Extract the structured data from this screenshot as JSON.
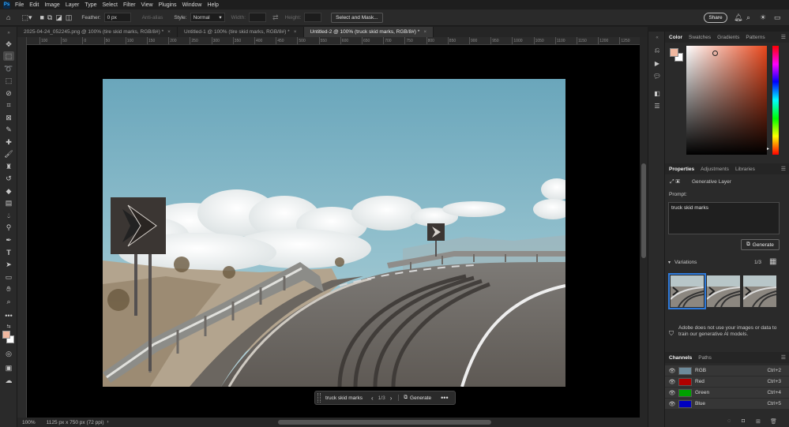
{
  "app": {
    "menu": [
      "File",
      "Edit",
      "Image",
      "Layer",
      "Type",
      "Select",
      "Filter",
      "View",
      "Plugins",
      "Window",
      "Help"
    ]
  },
  "options": {
    "feather_label": "Feather:",
    "feather_value": "0 px",
    "antialias_label": "Anti-alias",
    "style_label": "Style:",
    "style_value": "Normal",
    "width_label": "Width:",
    "height_label": "Height:",
    "select_mask_label": "Select and Mask...",
    "share_label": "Share"
  },
  "tabs": [
    {
      "label": "2025-04-24_052245.png @ 100% (tire skid marks, RGB/8#) *",
      "active": false
    },
    {
      "label": "Untitled-1 @ 100% (tire skid marks, RGB/8#) *",
      "active": false
    },
    {
      "label": "Untitled-2 @ 100% (truck skid marks, RGB/8#) *",
      "active": true
    }
  ],
  "ruler_ticks": [
    "100",
    "50",
    "0",
    "50",
    "100",
    "150",
    "200",
    "250",
    "300",
    "350",
    "400",
    "450",
    "500",
    "550",
    "600",
    "650",
    "700",
    "750",
    "800",
    "850",
    "900",
    "950",
    "1000",
    "1050",
    "1100",
    "1150",
    "1200",
    "1250"
  ],
  "context_bar": {
    "prompt": "truck skid marks",
    "count": "1/3",
    "generate_label": "Generate"
  },
  "status": {
    "zoom": "100%",
    "doc_info": "1125 px x 750 px (72 ppi)"
  },
  "color_panel": {
    "tabs": [
      "Color",
      "Swatches",
      "Gradients",
      "Patterns"
    ],
    "foreground": "#f0b8a0",
    "background": "#ffffff",
    "hue_color": "#e8471c"
  },
  "properties": {
    "tabs": [
      "Properties",
      "Adjustments",
      "Libraries"
    ],
    "layer_type": "Generative Layer",
    "prompt_label": "Prompt:",
    "prompt_value": "truck skid marks",
    "generate_label": "Generate",
    "variations_label": "Variations",
    "variations_count": "1/3",
    "disclaimer": "Adobe does not use your images or data to train our generative AI models."
  },
  "channels": {
    "tabs": [
      "Channels",
      "Paths"
    ],
    "rows": [
      {
        "name": "RGB",
        "shortcut": "Ctrl+2",
        "color": "#6d8a9a"
      },
      {
        "name": "Red",
        "shortcut": "Ctrl+3",
        "color": "#b00000"
      },
      {
        "name": "Green",
        "shortcut": "Ctrl+4",
        "color": "#00a000"
      },
      {
        "name": "Blue",
        "shortcut": "Ctrl+5",
        "color": "#0000c0"
      }
    ]
  }
}
